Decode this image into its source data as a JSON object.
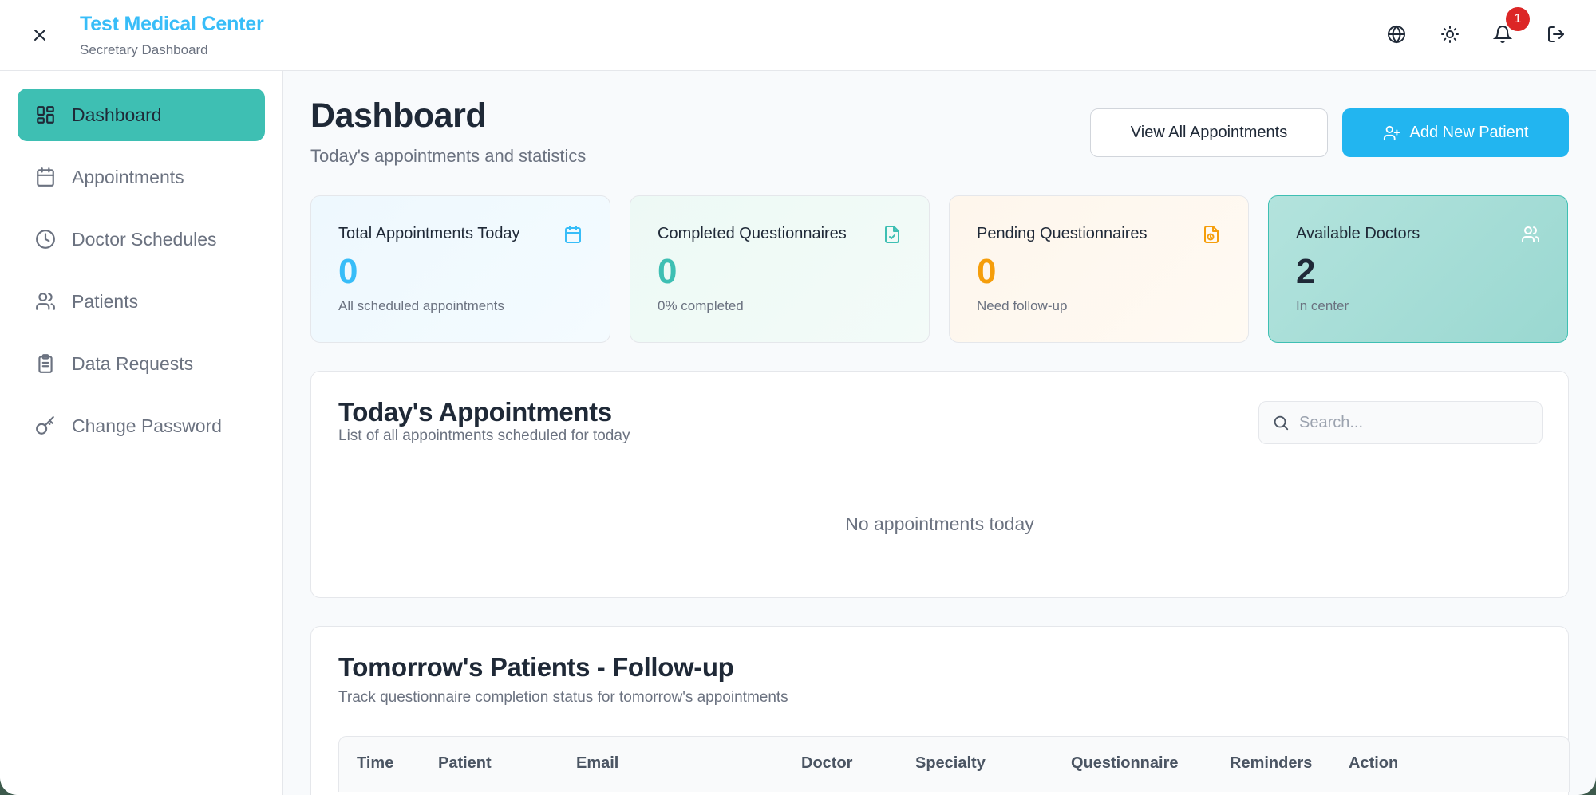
{
  "header": {
    "title": "Test Medical Center",
    "subtitle": "Secretary Dashboard",
    "notification_count": "1"
  },
  "sidebar": {
    "items": [
      {
        "label": "Dashboard",
        "icon": "dashboard-grid-icon",
        "active": true
      },
      {
        "label": "Appointments",
        "icon": "calendar-icon"
      },
      {
        "label": "Doctor Schedules",
        "icon": "clock-icon"
      },
      {
        "label": "Patients",
        "icon": "users-icon"
      },
      {
        "label": "Data Requests",
        "icon": "clipboard-icon"
      },
      {
        "label": "Change Password",
        "icon": "key-icon"
      }
    ]
  },
  "main": {
    "title": "Dashboard",
    "subtitle": "Today's appointments and statistics",
    "view_all_label": "View All Appointments",
    "add_patient_label": "Add New Patient"
  },
  "stats": [
    {
      "label": "Total Appointments Today",
      "value": "0",
      "desc": "All scheduled appointments",
      "icon": "calendar-icon",
      "color": "#38bdf8"
    },
    {
      "label": "Completed Questionnaires",
      "value": "0",
      "desc": "0% completed",
      "icon": "file-check-icon",
      "color": "#3ebfb3"
    },
    {
      "label": "Pending Questionnaires",
      "value": "0",
      "desc": "Need follow-up",
      "icon": "file-clock-icon",
      "color": "#f59e0b"
    },
    {
      "label": "Available Doctors",
      "value": "2",
      "desc": "In center",
      "icon": "users-icon",
      "color": "#1f2937"
    }
  ],
  "today_section": {
    "title": "Today's Appointments",
    "subtitle": "List of all appointments scheduled for today",
    "search_placeholder": "Search...",
    "empty_message": "No appointments today"
  },
  "tomorrow_section": {
    "title": "Tomorrow's Patients - Follow-up",
    "subtitle": "Track questionnaire completion status for tomorrow's appointments",
    "columns": [
      "Time",
      "Patient",
      "Email",
      "Doctor",
      "Specialty",
      "Questionnaire",
      "Reminders",
      "Action"
    ]
  },
  "colors": {
    "accent_teal": "#3ebfb3",
    "accent_blue": "#22b5f0",
    "brand_title": "#38bdf8",
    "badge_red": "#dc2626"
  }
}
